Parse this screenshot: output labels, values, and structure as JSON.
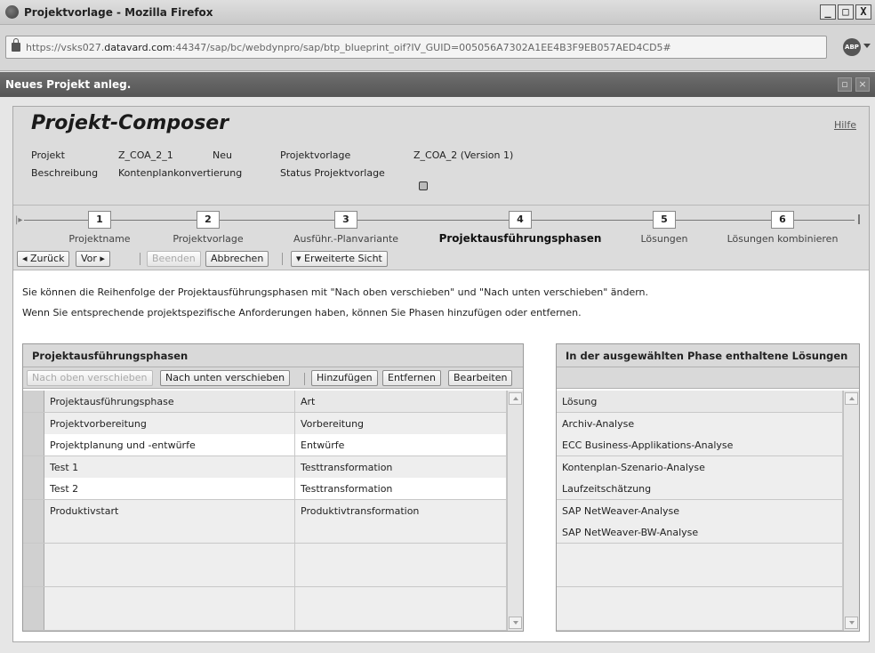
{
  "window": {
    "title": "Projektvorlage - Mozilla Firefox",
    "min_label": "_",
    "max_label": "□",
    "close_label": "X"
  },
  "browser": {
    "url_prefix": "https://vsks027.",
    "url_domain": "datavard.com",
    "url_suffix": ":44347/sap/bc/webdynpro/sap/btp_blueprint_oif?IV_GUID=005056A7302A1EE4B3F9EB057AED4CD5#",
    "addon_label": "ABP"
  },
  "dialog": {
    "title": "Neues Projekt anleg.",
    "restore_label": "▫",
    "close_label": "×"
  },
  "composer": {
    "title": "Projekt-Composer",
    "help": "Hilfe",
    "projekt_label": "Projekt",
    "projekt_value": "Z_COA_2_1",
    "projekt_status": "Neu",
    "beschreibung_label": "Beschreibung",
    "beschreibung_value": "Kontenplankonvertierung",
    "vorlage_label": "Projektvorlage",
    "vorlage_value": "Z_COA_2 (Version 1)",
    "status_vorlage_label": "Status Projektvorlage"
  },
  "roadmap": {
    "steps": [
      {
        "num": "1",
        "label": "Projektname"
      },
      {
        "num": "2",
        "label": "Projektvorlage"
      },
      {
        "num": "3",
        "label": "Ausführ.-Planvariante"
      },
      {
        "num": "4",
        "label": "Projektausführungsphasen"
      },
      {
        "num": "5",
        "label": "Lösungen"
      },
      {
        "num": "6",
        "label": "Lösungen kombinieren"
      }
    ]
  },
  "toolbar": {
    "back": "◂ Zurück",
    "next": "Vor ▸",
    "finish": "Beenden",
    "cancel": "Abbrechen",
    "extended": "▾ Erweiterte Sicht"
  },
  "description": {
    "line1": "Sie können die Reihenfolge der Projektausführungsphasen mit \"Nach oben verschieben\" und \"Nach unten verschieben\" ändern.",
    "line2": "Wenn Sie entsprechende projektspezifische Anforderungen haben, können Sie Phasen hinzufügen oder entfernen."
  },
  "phases_table": {
    "title": "Projektausführungsphasen",
    "buttons": {
      "move_up": "Nach oben verschieben",
      "move_down": "Nach unten verschieben",
      "add": "Hinzufügen",
      "remove": "Entfernen",
      "edit": "Bearbeiten"
    },
    "columns": [
      "Projektausführungsphase",
      "Art"
    ],
    "rows": [
      [
        "Projektvorbereitung",
        "Vorbereitung"
      ],
      [
        "Projektplanung und -entwürfe",
        "Entwürfe"
      ],
      [
        "Test 1",
        "Testtransformation"
      ],
      [
        "Test 2",
        "Testtransformation"
      ],
      [
        "Produktivstart",
        "Produktivtransformation"
      ]
    ]
  },
  "solutions_table": {
    "title": "In der ausgewählten Phase enthaltene Lösungen",
    "columns": [
      "Lösung"
    ],
    "rows": [
      "Archiv-Analyse",
      "ECC Business-Applikations-Analyse",
      "Kontenplan-Szenario-Analyse",
      "Laufzeitschätzung",
      "SAP NetWeaver-Analyse",
      "SAP NetWeaver-BW-Analyse"
    ]
  }
}
